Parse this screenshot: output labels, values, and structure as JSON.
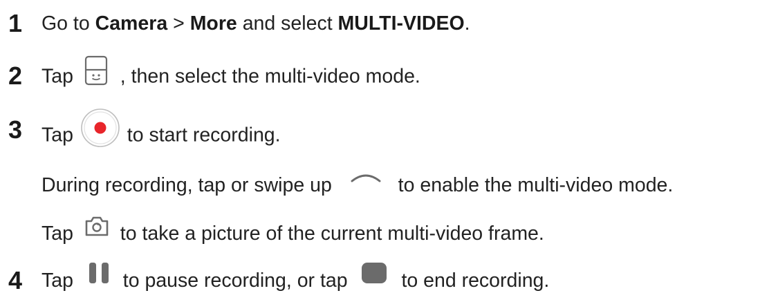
{
  "steps": [
    {
      "number": "1",
      "parts": {
        "a": "Go to ",
        "b": "Camera",
        "c": " > ",
        "d": "More",
        "e": " and select ",
        "f": "MULTI-VIDEO",
        "g": "."
      }
    },
    {
      "number": "2",
      "before": "Tap",
      "icon": "multi-video-mode-icon",
      "after": ", then select the multi-video mode."
    },
    {
      "number": "3",
      "before": "Tap",
      "icon": "record-button-icon",
      "after": "to start recording.",
      "notes": [
        {
          "before": "During recording, tap or swipe up",
          "icon": "chevron-up-icon",
          "after": "to enable the multi-video mode."
        },
        {
          "before": "Tap",
          "icon": "camera-capture-icon",
          "after": "to take a picture of the current multi-video frame."
        }
      ]
    },
    {
      "number": "4",
      "before": "Tap",
      "icon1": "pause-icon",
      "middle": "to pause recording, or tap",
      "icon2": "stop-icon",
      "after": "to end recording."
    }
  ],
  "colors": {
    "text": "#222222",
    "icon_gray": "#6b6b6b",
    "record_red": "#e8252a"
  }
}
